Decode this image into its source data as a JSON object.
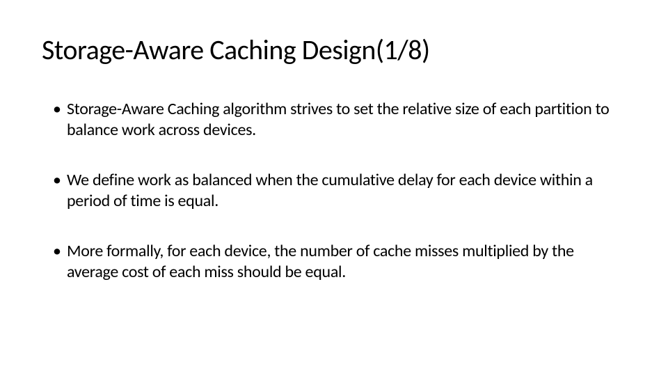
{
  "slide": {
    "title": "Storage-Aware Caching Design(1/8)",
    "bullets": [
      "Storage-Aware Caching  algorithm strives to set the relative size of each partition to balance work across devices.",
      "We define work as balanced when the cumulative delay for each device within a period of time is equal.",
      "More formally, for each device, the number of cache misses multiplied by the average cost of each miss should be equal."
    ]
  }
}
